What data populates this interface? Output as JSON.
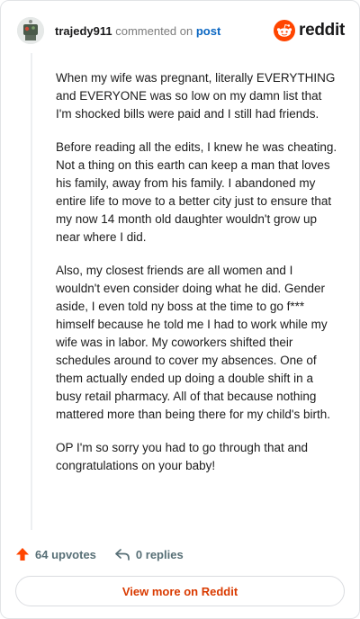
{
  "header": {
    "username": "trajedy911",
    "action_text": "commented on",
    "post_link": "post",
    "brand_name": "reddit"
  },
  "comment": {
    "paragraphs": [
      "When my wife was pregnant, literally EVERYTHING and EVERYONE was so low on my damn list that I'm shocked bills were paid and I still had friends.",
      "Before reading all the edits, I knew he was cheating. Not a thing on this earth can keep a man that loves his family, away from his family. I abandoned my entire life to move to a better city just to ensure that my now 14 month old daughter wouldn't grow up near where I did.",
      "Also, my closest friends are all women and I wouldn't even consider doing what he did. Gender aside, I even told ny boss at the time to go f*** himself because he told me I had to work while my wife was in labor. My coworkers shifted their schedules around to cover my absences. One of them actually ended up doing a double shift in a busy retail pharmacy. All of that because nothing mattered more than being there for my child's birth.",
      "OP I'm so sorry you had to go through that and congratulations on your baby!"
    ]
  },
  "footer": {
    "upvotes": "64 upvotes",
    "replies": "0 replies"
  },
  "cta": {
    "view_more": "View more on Reddit"
  },
  "colors": {
    "brand_orange": "#ff4500",
    "link_blue": "#0a66c2",
    "cta_text": "#d93a00"
  },
  "icons": [
    "avatar",
    "reddit-logo-icon",
    "upvote-arrow-icon",
    "reply-icon"
  ]
}
